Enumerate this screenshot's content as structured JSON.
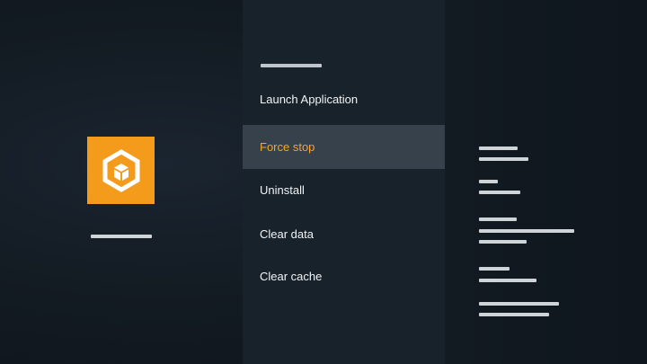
{
  "app": {
    "icon_name": "cube-in-hexagon-icon",
    "icon_color": "#f59b1c"
  },
  "menu": {
    "items": [
      {
        "label": "Launch Application",
        "selected": false
      },
      {
        "label": "Force stop",
        "selected": true
      },
      {
        "label": "Uninstall",
        "selected": false
      },
      {
        "label": "Clear data",
        "selected": false
      },
      {
        "label": "Clear cache",
        "selected": false
      }
    ],
    "selected_color": "#f5a623",
    "selected_background": "#36414b"
  }
}
